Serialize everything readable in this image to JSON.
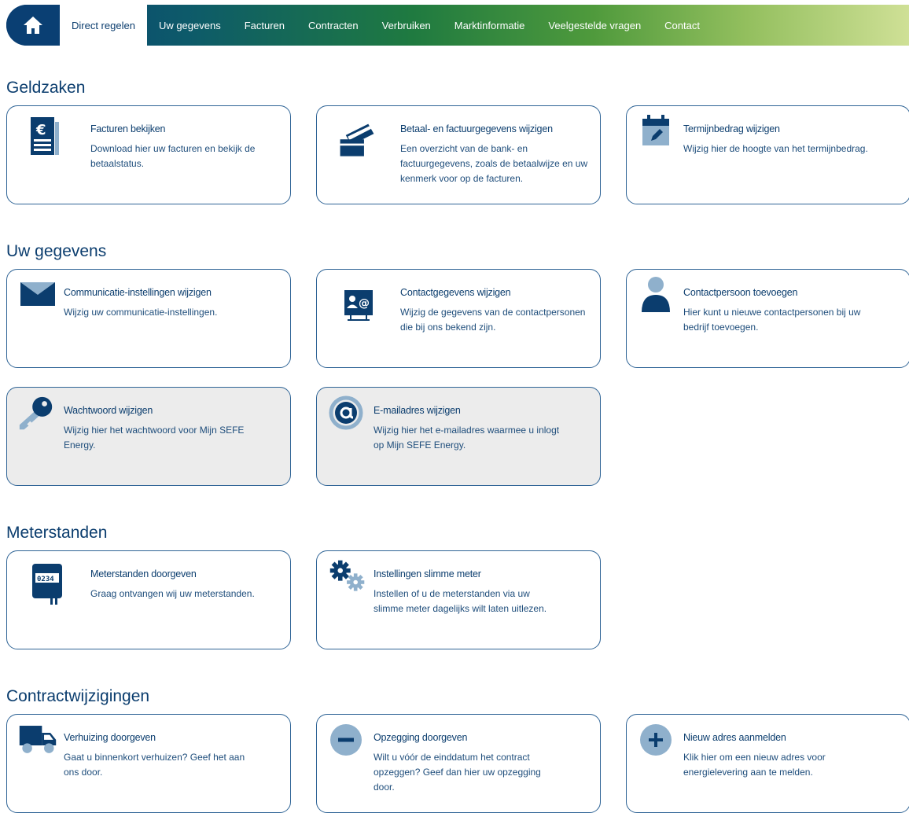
{
  "nav": {
    "home_icon": "home-icon",
    "items": [
      {
        "label": "Direct regelen",
        "active": true
      },
      {
        "label": "Uw gegevens"
      },
      {
        "label": "Facturen"
      },
      {
        "label": "Contracten"
      },
      {
        "label": "Verbruiken"
      },
      {
        "label": "Marktinformatie"
      },
      {
        "label": "Veelgestelde vragen"
      },
      {
        "label": "Contact"
      }
    ]
  },
  "sections": [
    {
      "title": "Geldzaken",
      "cards": [
        {
          "icon": "invoice-euro-icon",
          "title": "Facturen bekijken",
          "desc": "Download hier uw facturen en bekijk de betaalstatus."
        },
        {
          "icon": "credit-card-icon",
          "title": "Betaal- en factuurgegevens wijzigen",
          "desc": "Een overzicht van de bank- en factuurgegevens, zoals de betaalwijze en uw kenmerk voor op de facturen."
        },
        {
          "icon": "calendar-edit-icon",
          "title": "Termijnbedrag wijzigen",
          "desc": "Wijzig hier de hoogte van het termijnbedrag."
        }
      ]
    },
    {
      "title": "Uw gegevens",
      "cards": [
        {
          "icon": "envelope-icon",
          "title": "Communicatie-instellingen wijzigen",
          "desc": "Wijzig uw communicatie-instellingen."
        },
        {
          "icon": "contact-card-icon",
          "title": "Contactgegevens wijzigen",
          "desc": "Wijzig de gegevens van de contactpersonen die bij ons bekend zijn."
        },
        {
          "icon": "person-icon",
          "title": "Contactpersoon toevoegen",
          "desc": "Hier kunt u nieuwe contactpersonen bij uw bedrijf toevoegen."
        },
        {
          "icon": "key-icon",
          "title": "Wachtwoord wijzigen",
          "desc": "Wijzig hier het wachtwoord voor Mijn SEFE Energy."
        },
        {
          "icon": "at-sign-icon",
          "title": "E-mailadres wijzigen",
          "desc": "Wijzig hier het e-mailadres waarmee u inlogt op Mijn SEFE Energy."
        }
      ]
    },
    {
      "title": "Meterstanden",
      "cards": [
        {
          "icon": "meter-icon",
          "title": "Meterstanden doorgeven",
          "desc": "Graag ontvangen wij uw meterstanden.",
          "meter_digits": "0234"
        },
        {
          "icon": "gears-icon",
          "title": "Instellingen slimme meter",
          "desc": "Instellen of u de meterstanden via uw slimme meter dagelijks wilt laten uitlezen."
        }
      ]
    },
    {
      "title": "Contractwijzigingen",
      "cards": [
        {
          "icon": "truck-icon",
          "title": "Verhuizing doorgeven",
          "desc": "Gaat u binnenkort verhuizen? Geef het aan ons door."
        },
        {
          "icon": "minus-circle-icon",
          "title": "Opzegging doorgeven",
          "desc": "Wilt u vóór de einddatum het contract opzeggen? Geef dan hier uw opzegging door."
        },
        {
          "icon": "plus-circle-icon",
          "title": "Nieuw adres aanmelden",
          "desc": "Klik hier om een nieuw adres voor energielevering aan te melden."
        }
      ]
    }
  ],
  "colors": {
    "primary": "#0b3d6e",
    "icon_light": "#8fb0cc",
    "card_border": "#2f6496",
    "disabled_bg": "#ececec"
  }
}
